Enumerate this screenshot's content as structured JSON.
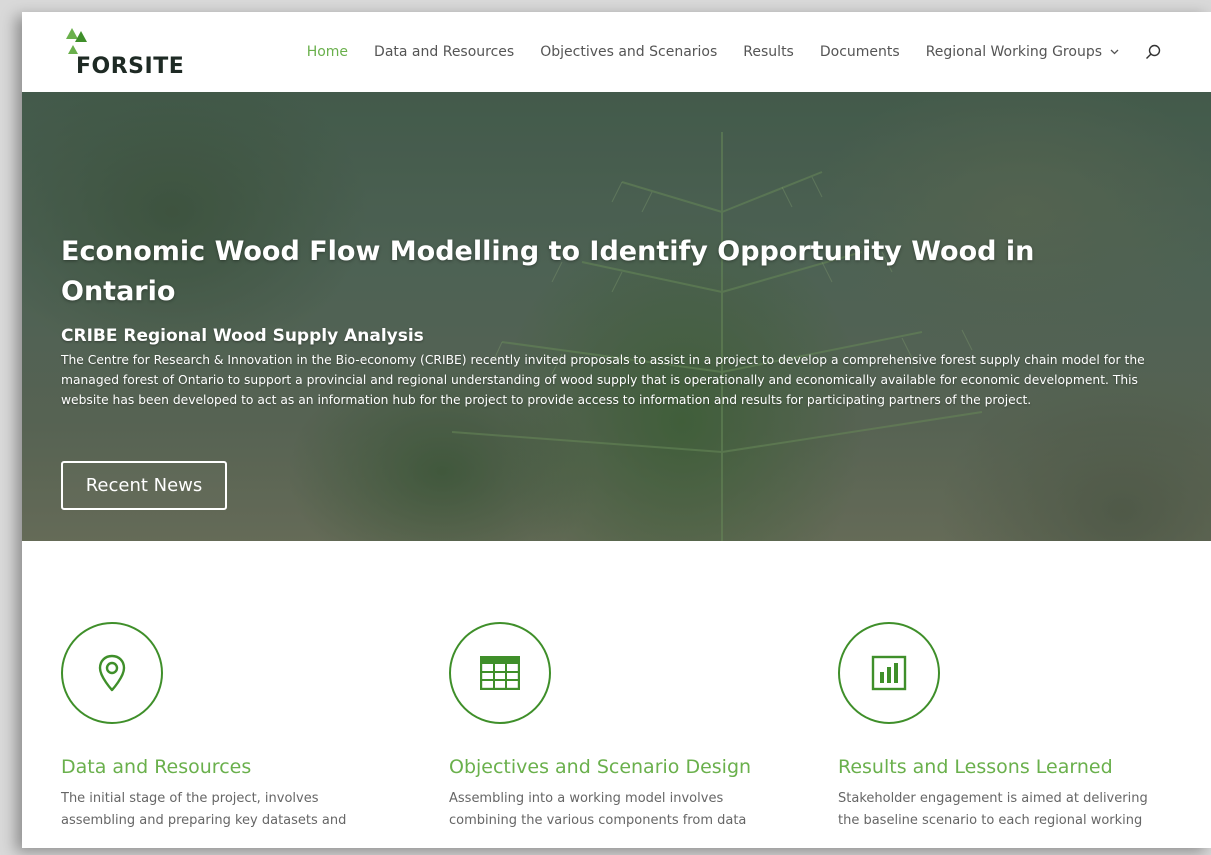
{
  "brand": {
    "name": "FORSITE",
    "accent": "#6ab04c",
    "icon_green": "#3f8f2a"
  },
  "nav": {
    "items": [
      {
        "label": "Home",
        "active": true
      },
      {
        "label": "Data and Resources"
      },
      {
        "label": "Objectives and Scenarios"
      },
      {
        "label": "Results"
      },
      {
        "label": "Documents"
      },
      {
        "label": "Regional Working Groups",
        "dropdown": true
      }
    ],
    "search_icon": "search-icon"
  },
  "hero": {
    "title": "Economic Wood Flow Modelling to Identify Opportunity Wood in Ontario",
    "subtitle": "CRIBE Regional Wood Supply Analysis",
    "text": "The Centre for Research & Innovation in the Bio-economy (CRIBE) recently invited proposals to assist in a project to develop a comprehensive forest supply chain model for the managed forest of Ontario to support a provincial and regional understanding of wood supply that is operationally and economically available for economic development.  This website has been developed to act as an information hub for the project to provide access to information and results for participating partners of the project.",
    "button": "Recent News"
  },
  "features": [
    {
      "icon": "map-pin-icon",
      "title": "Data and Resources",
      "text": "The initial stage of the project, involves assembling and preparing key datasets and"
    },
    {
      "icon": "table-icon",
      "title": "Objectives and Scenario Design",
      "text": "Assembling into a working model involves combining the various components from data"
    },
    {
      "icon": "bar-chart-icon",
      "title": "Results and Lessons Learned",
      "text": "Stakeholder engagement is aimed at delivering the baseline scenario to each regional working"
    }
  ]
}
